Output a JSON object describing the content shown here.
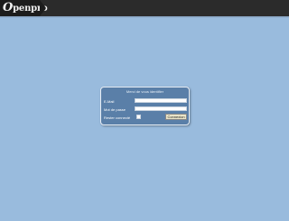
{
  "header": {
    "logo_text": "penpro",
    "logo_initial": "O"
  },
  "login": {
    "title": "Merci de vous identifier",
    "email_label": "E-Mail",
    "email_value": "",
    "password_label": "Mot de passe",
    "password_value": "",
    "remember_label": "Rester connecté",
    "remember_checked": false,
    "connect_label": "Connexion"
  },
  "colors": {
    "background": "#99bbdd",
    "topbar": "#2b2b2b",
    "login_panel": "#5a7fa8",
    "button": "#e9e4c8"
  }
}
